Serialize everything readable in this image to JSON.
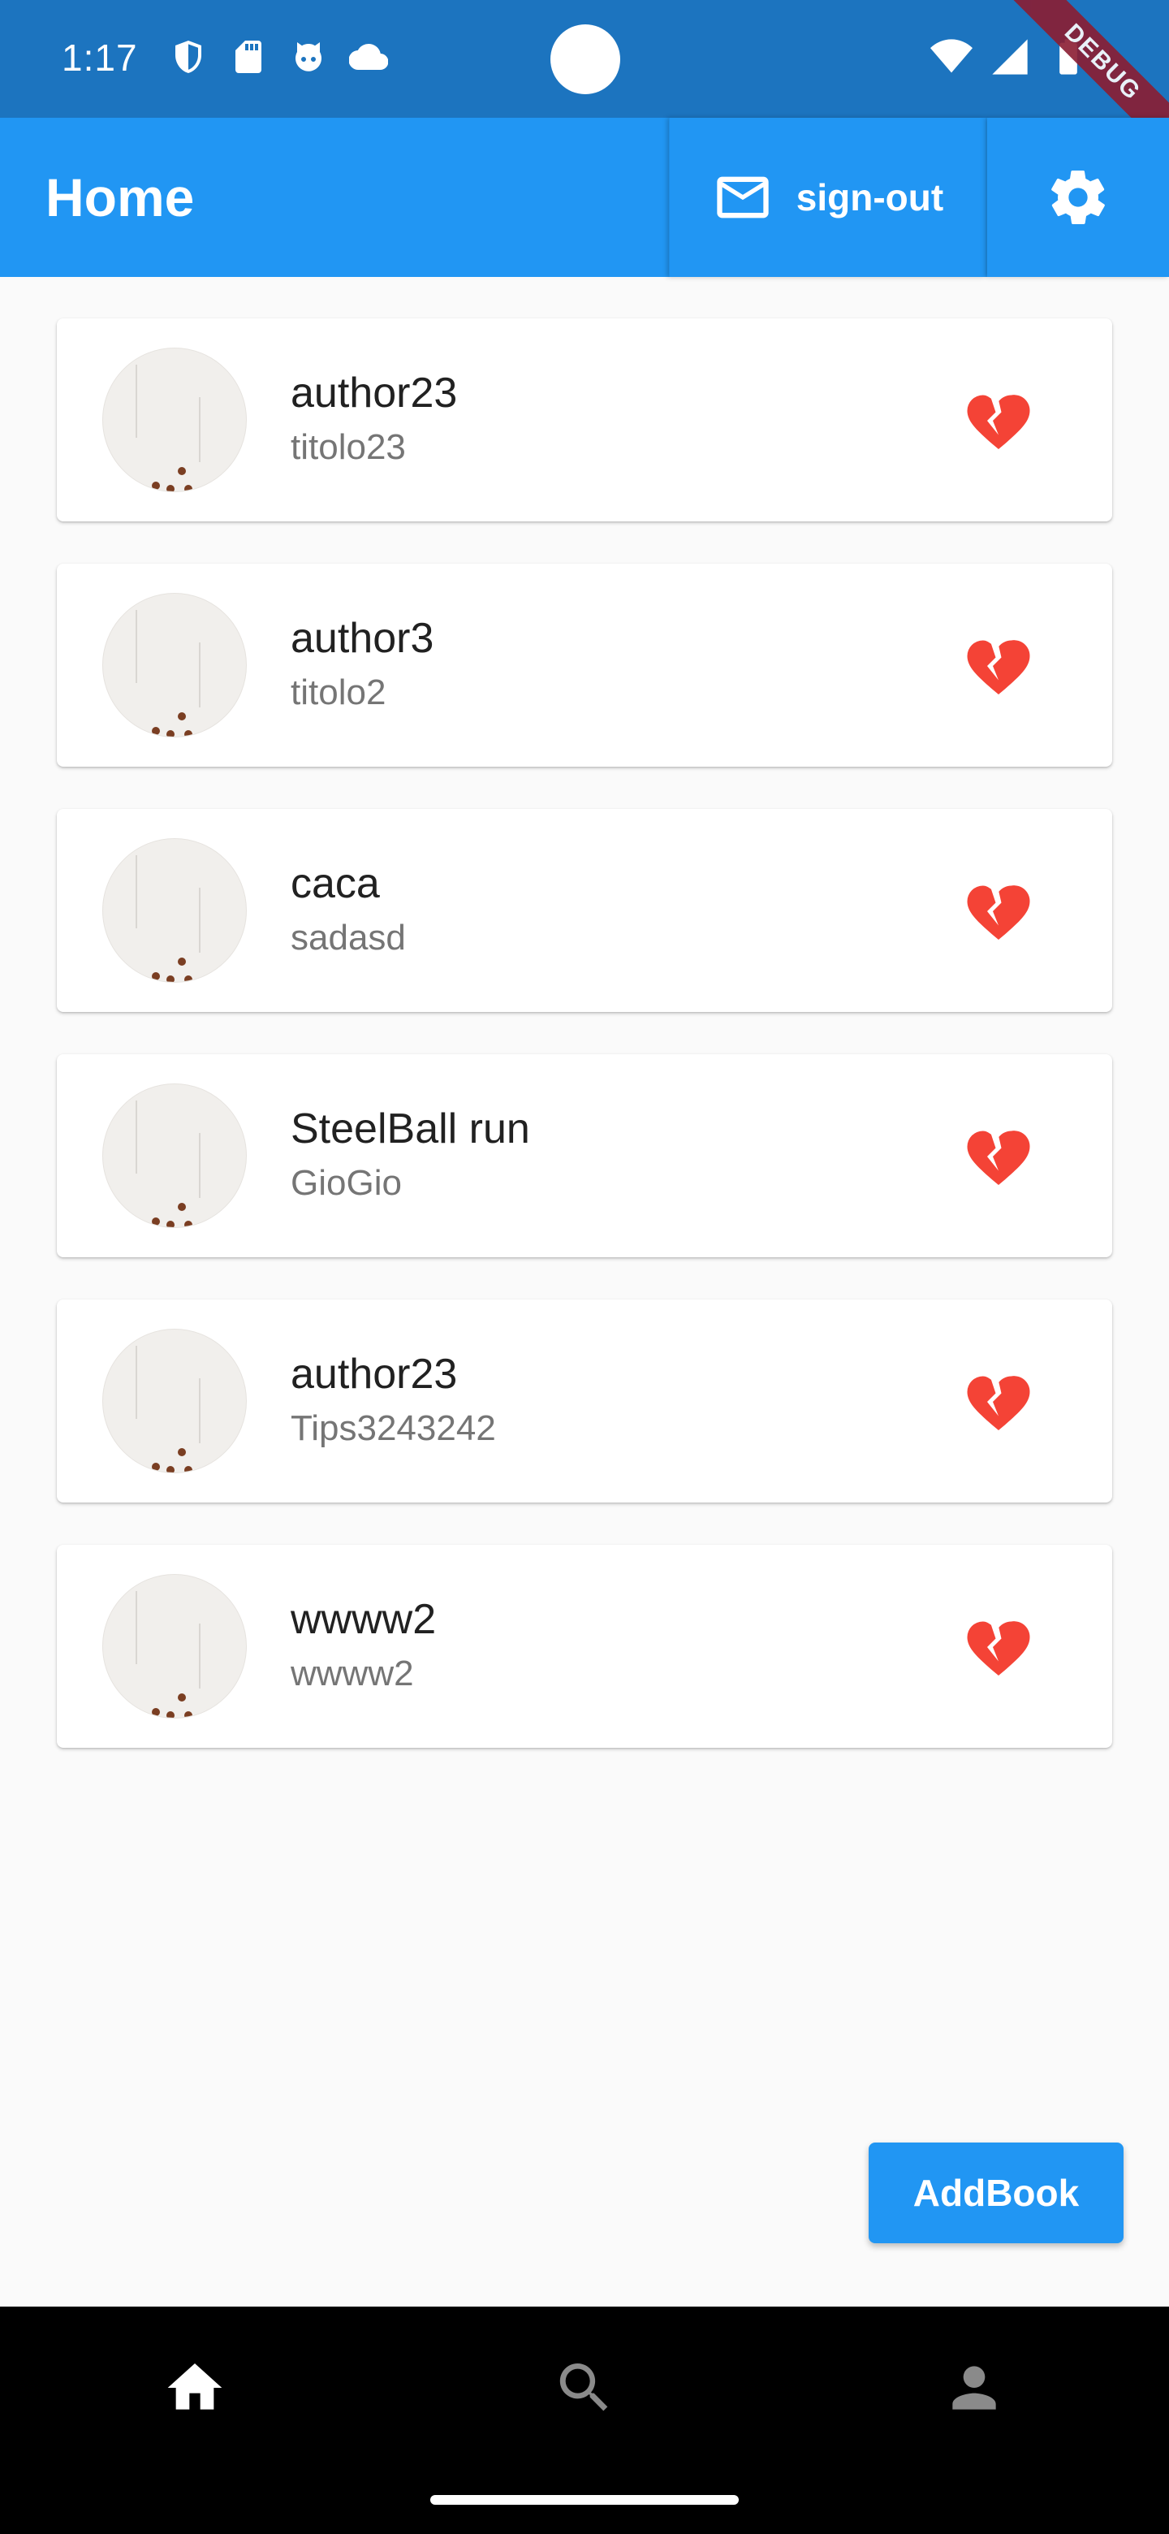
{
  "status_bar": {
    "time": "1:17",
    "left_icons": [
      "shield-icon",
      "sd-card-icon",
      "cat-icon",
      "cloud-icon"
    ],
    "right_icons": [
      "wifi-icon",
      "signal-icon",
      "battery-icon"
    ],
    "debug_label": "DEBUG"
  },
  "app_bar": {
    "title": "Home",
    "signout_label": "sign-out",
    "signout_icon": "mail-icon",
    "settings_icon": "gear-icon",
    "color": "#2196f3"
  },
  "books": [
    {
      "title": "author23",
      "subtitle": "titolo23"
    },
    {
      "title": "author3",
      "subtitle": "titolo2"
    },
    {
      "title": "caca",
      "subtitle": "sadasd"
    },
    {
      "title": "SteelBall run",
      "subtitle": "GioGio"
    },
    {
      "title": "author23",
      "subtitle": "Tips3243242"
    },
    {
      "title": "wwww2",
      "subtitle": "wwww2"
    }
  ],
  "book_action_icon": "broken-heart-icon",
  "heart_color": "#f44336",
  "fab": {
    "label": "AddBook"
  },
  "bottom_nav": {
    "items": [
      {
        "icon": "home-icon",
        "active": true
      },
      {
        "icon": "search-icon",
        "active": false
      },
      {
        "icon": "person-icon",
        "active": false
      }
    ]
  }
}
